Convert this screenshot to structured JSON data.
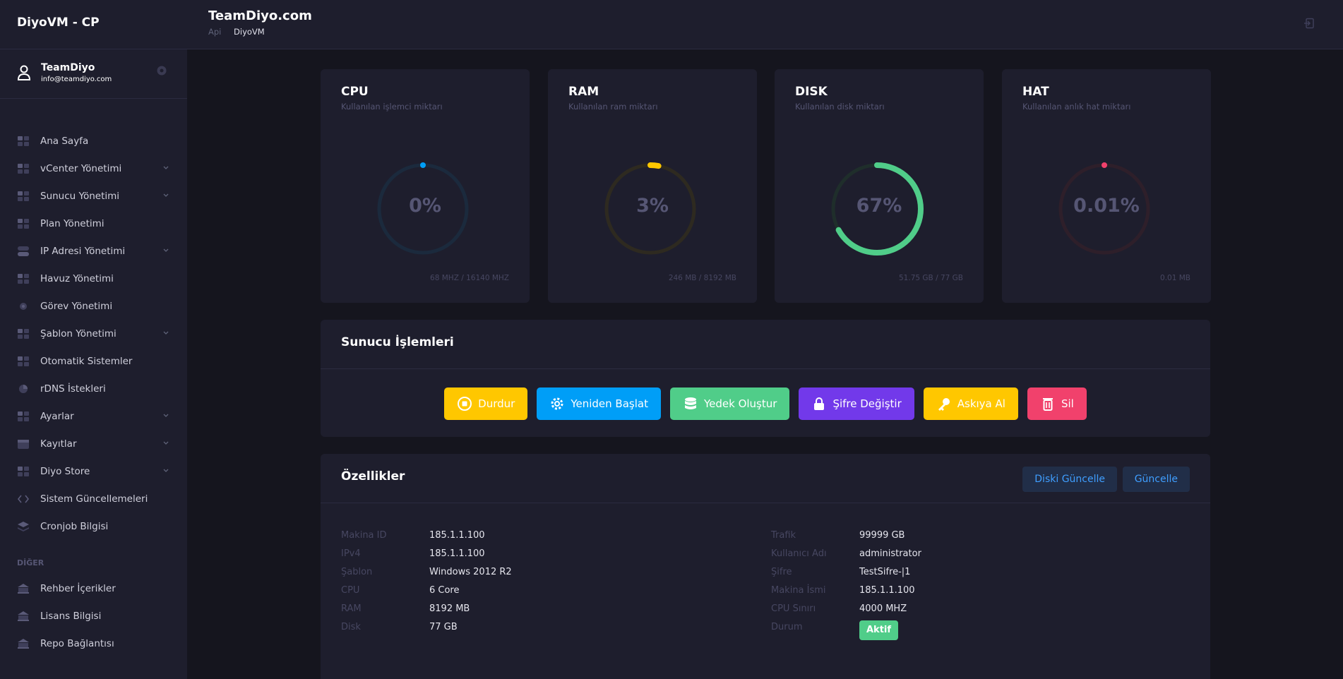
{
  "sidebar": {
    "brand": "DiyoVM - CP",
    "user": {
      "name": "TeamDiyo",
      "email": "info@teamdiyo.com"
    },
    "items": [
      {
        "label": "Ana Sayfa",
        "icon": "grid-icon",
        "chevron": false
      },
      {
        "label": "vCenter Yönetimi",
        "icon": "server-icon",
        "chevron": true
      },
      {
        "label": "Sunucu Yönetimi",
        "icon": "layout-icon",
        "chevron": true
      },
      {
        "label": "Plan Yönetimi",
        "icon": "dots-icon",
        "chevron": false
      },
      {
        "label": "IP Adresi Yönetimi",
        "icon": "toggle-icon",
        "chevron": true
      },
      {
        "label": "Havuz Yönetimi",
        "icon": "grid-icon",
        "chevron": false
      },
      {
        "label": "Görev Yönetimi",
        "icon": "circle-icon",
        "chevron": false
      },
      {
        "label": "Şablon Yönetimi",
        "icon": "map-icon",
        "chevron": true
      },
      {
        "label": "Otomatik Sistemler",
        "icon": "building-icon",
        "chevron": false
      },
      {
        "label": "rDNS İstekleri",
        "icon": "pie-icon",
        "chevron": false
      },
      {
        "label": "Ayarlar",
        "icon": "grid-icon",
        "chevron": true
      },
      {
        "label": "Kayıtlar",
        "icon": "calendar-icon",
        "chevron": true
      },
      {
        "label": "Diyo Store",
        "icon": "store-icon",
        "chevron": true
      },
      {
        "label": "Sistem Güncellemeleri",
        "icon": "code-icon",
        "chevron": false
      },
      {
        "label": "Cronjob Bilgisi",
        "icon": "layers-icon",
        "chevron": false
      }
    ],
    "section_label": "DİĞER",
    "other_items": [
      {
        "label": "Rehber İçerikler",
        "icon": "bank-icon"
      },
      {
        "label": "Lisans Bilgisi",
        "icon": "bank-icon"
      },
      {
        "label": "Repo Bağlantısı",
        "icon": "bank-icon"
      }
    ]
  },
  "header": {
    "title": "TeamDiyo.com",
    "breadcrumb": [
      "Api",
      "DiyoVM"
    ]
  },
  "stats": [
    {
      "title": "CPU",
      "subtitle": "Kullanılan işlemci miktarı",
      "value": "0%",
      "fraction": 0.0,
      "foot": "68 MHZ / 16140 MHZ",
      "color": "#009ef7",
      "track": "#1b2a3d"
    },
    {
      "title": "RAM",
      "subtitle": "Kullanılan ram miktarı",
      "value": "3%",
      "fraction": 0.03,
      "foot": "246 MB / 8192 MB",
      "color": "#ffc700",
      "track": "#2e2a20"
    },
    {
      "title": "DISK",
      "subtitle": "Kullanılan disk miktarı",
      "value": "67%",
      "fraction": 0.67,
      "foot": "51.75 GB / 77 GB",
      "color": "#50cd89",
      "track": "#1f2e2b"
    },
    {
      "title": "HAT",
      "subtitle": "Kullanılan anlık hat miktarı",
      "value": "0.01%",
      "fraction": 0.0001,
      "foot": "0.01 MB",
      "color": "#f1416c",
      "track": "#2e1f2a"
    }
  ],
  "operations": {
    "title": "Sunucu İşlemleri",
    "buttons": [
      {
        "label": "Durdur",
        "color": "#ffc700",
        "icon": "stop-icon"
      },
      {
        "label": "Yeniden Başlat",
        "color": "#009ef7",
        "icon": "gear-icon"
      },
      {
        "label": "Yedek Oluştur",
        "color": "#50cd89",
        "icon": "database-icon"
      },
      {
        "label": "Şifre Değiştir",
        "color": "#7239ea",
        "icon": "lock-icon"
      },
      {
        "label": "Askıya Al",
        "color": "#ffc700",
        "icon": "key-icon"
      },
      {
        "label": "Sil",
        "color": "#f1416c",
        "icon": "trash-icon"
      }
    ]
  },
  "features": {
    "title": "Özellikler",
    "update_disk_label": "Diski Güncelle",
    "update_label": "Güncelle",
    "left": [
      {
        "key": "Makina ID",
        "value": "185.1.1.100"
      },
      {
        "key": "IPv4",
        "value": "185.1.1.100"
      },
      {
        "key": "Şablon",
        "value": "Windows 2012 R2"
      },
      {
        "key": "CPU",
        "value": "6 Core"
      },
      {
        "key": "RAM",
        "value": "8192 MB"
      },
      {
        "key": "Disk",
        "value": "77 GB"
      }
    ],
    "right": [
      {
        "key": "Trafik",
        "value": "99999 GB"
      },
      {
        "key": "Kullanıcı Adı",
        "value": "administrator"
      },
      {
        "key": "Şifre",
        "value": "TestSifre-|1"
      },
      {
        "key": "Makina İsmi",
        "value": "185.1.1.100"
      },
      {
        "key": "CPU Sınırı",
        "value": "4000 MHZ"
      }
    ],
    "status_key": "Durum",
    "status_value": "Aktif"
  }
}
